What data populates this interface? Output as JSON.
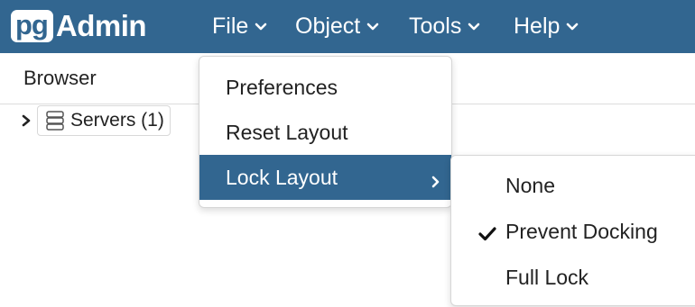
{
  "app": {
    "logo_pg": "pg",
    "logo_admin": "Admin"
  },
  "navbar": {
    "menus": [
      {
        "label": "File",
        "icon": "chevron-down-icon"
      },
      {
        "label": "Object",
        "icon": "chevron-down-icon"
      },
      {
        "label": "Tools",
        "icon": "chevron-down-icon"
      },
      {
        "label": "Help",
        "icon": "chevron-down-icon"
      }
    ],
    "bg_color": "#326690"
  },
  "browser": {
    "title": "Browser",
    "tree": {
      "expand_icon": "chevron-right-icon",
      "server_icon": "server-icon",
      "server_label": "Servers (1)"
    }
  },
  "file_menu": {
    "items": [
      {
        "label": "Preferences"
      },
      {
        "label": "Reset Layout"
      },
      {
        "label": "Lock Layout",
        "active": true,
        "has_submenu": true
      }
    ]
  },
  "lock_layout_submenu": {
    "items": [
      {
        "label": "None",
        "checked": false
      },
      {
        "label": "Prevent Docking",
        "checked": true
      },
      {
        "label": "Full Lock",
        "checked": false
      }
    ]
  }
}
